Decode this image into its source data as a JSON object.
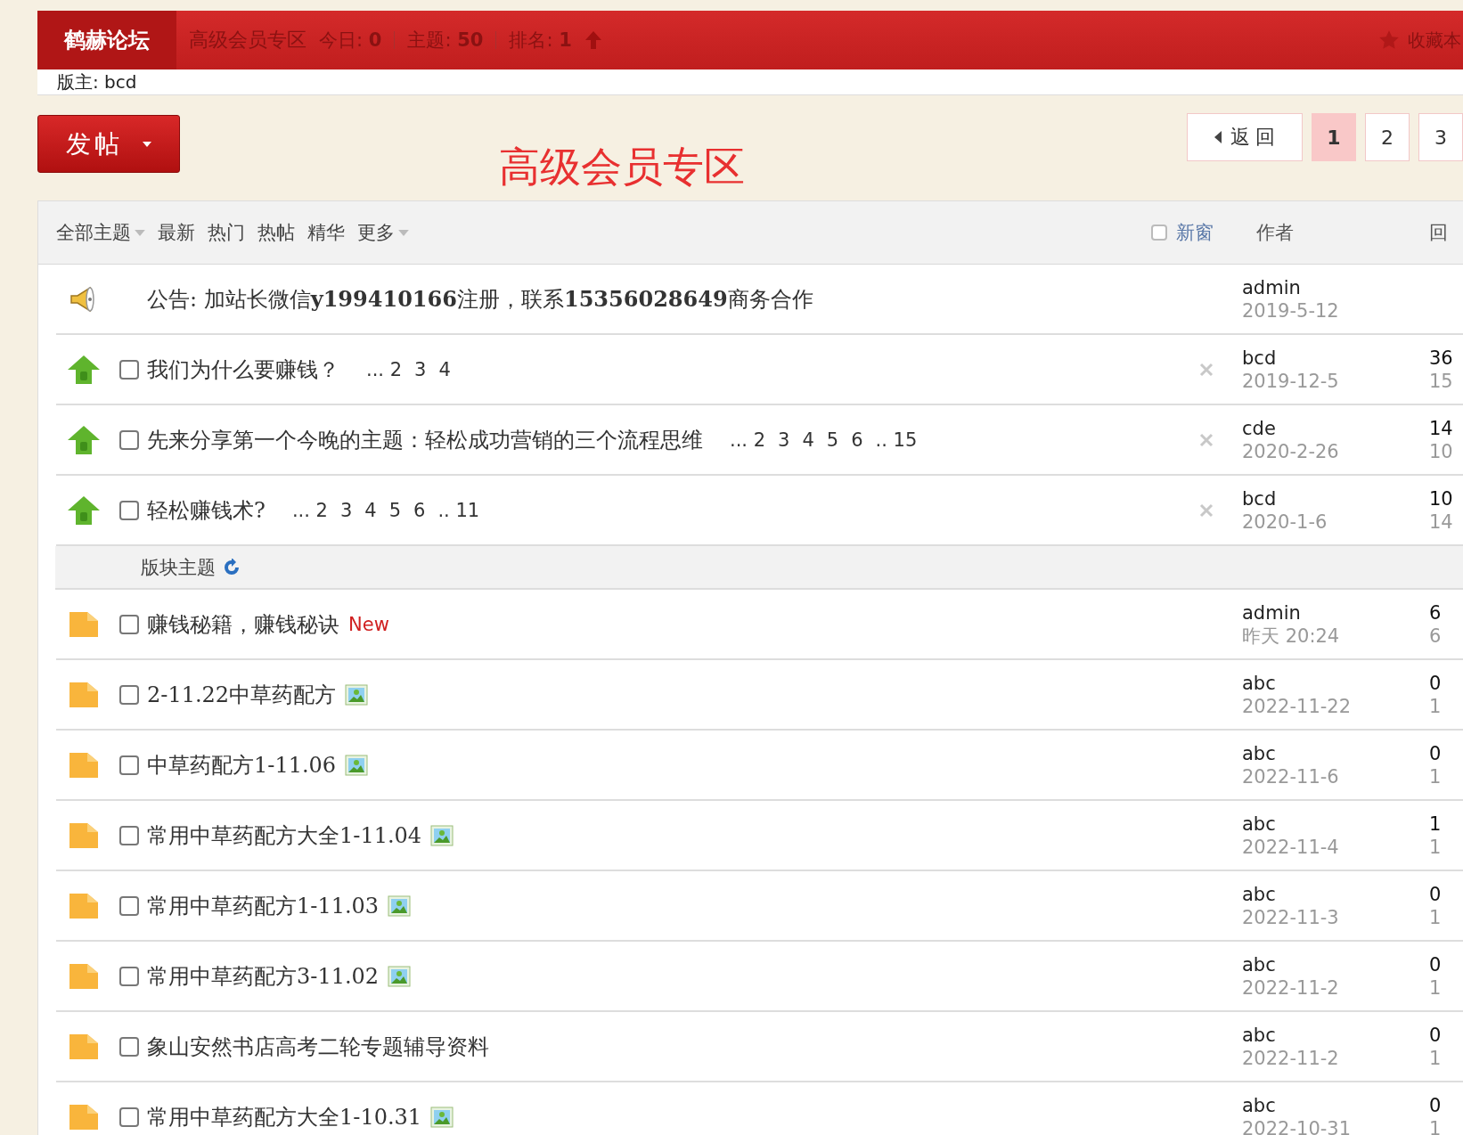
{
  "header": {
    "logo": "鹤赫论坛",
    "forum_name": "高级会员专区",
    "stats": [
      "今日: **0**",
      "主题: **50**",
      "排名: **1**"
    ],
    "moderator": "版主: bcd",
    "favorite": "收藏本"
  },
  "post_button": {
    "label": "发帖"
  },
  "forum_title": "高级会员专区",
  "pager": {
    "back": "返 回",
    "pages": [
      {
        "label": "1",
        "selected": true
      },
      {
        "label": "2",
        "selected": false
      },
      {
        "label": "3",
        "selected": false
      }
    ]
  },
  "filters": [
    {
      "label": "全部主题",
      "dropdown": true
    },
    {
      "label": "最新",
      "dropdown": false
    },
    {
      "label": "热门",
      "dropdown": false
    },
    {
      "label": "热帖",
      "dropdown": false
    },
    {
      "label": "精华",
      "dropdown": false
    },
    {
      "label": "更多",
      "dropdown": true
    }
  ],
  "new_window": {
    "label": "新窗",
    "checked": false
  },
  "columns": {
    "author": "作者",
    "replies": "回"
  },
  "threads": [
    {
      "kind": "announcement",
      "title": "公告: 加站长微信**y199410166**注册，联系**15356028649**商务合作",
      "author": "admin",
      "date": "2019-5-12"
    },
    {
      "kind": "sticky",
      "title": "我们为什么要赚钱？",
      "pages": [
        "... 2",
        "3",
        "4"
      ],
      "checked": false,
      "author": "bcd",
      "date": "2019-12-5",
      "replies": "36",
      "views": "15"
    },
    {
      "kind": "sticky",
      "title": "先来分享第一个今晚的主题：轻松成功营销的三个流程思维",
      "pages": [
        "... 2",
        "3",
        "4",
        "5",
        "6",
        ".. 15"
      ],
      "checked": false,
      "author": "cde",
      "date": "2020-2-26",
      "replies": "14",
      "views": "10"
    },
    {
      "kind": "sticky",
      "title": "轻松赚钱术?",
      "pages": [
        "... 2",
        "3",
        "4",
        "5",
        "6",
        ".. 11"
      ],
      "checked": false,
      "author": "bcd",
      "date": "2020-1-6",
      "replies": "10",
      "views": "14"
    },
    {
      "kind": "section",
      "title": "版块主题"
    },
    {
      "kind": "normal",
      "title": "赚钱秘籍，赚钱秘诀",
      "new": "New",
      "image": false,
      "checked": false,
      "author": "admin",
      "date": "昨天 20:24",
      "replies": "6",
      "views": "6"
    },
    {
      "kind": "normal",
      "title": "2-11.22中草药配方",
      "image": true,
      "checked": false,
      "author": "abc",
      "date": "2022-11-22",
      "replies": "0",
      "views": "1"
    },
    {
      "kind": "normal",
      "title": "中草药配方1-11.06",
      "image": true,
      "checked": false,
      "author": "abc",
      "date": "2022-11-6",
      "replies": "0",
      "views": "1"
    },
    {
      "kind": "normal",
      "title": "常用中草药配方大全1-11.04",
      "image": true,
      "checked": false,
      "author": "abc",
      "date": "2022-11-4",
      "replies": "1",
      "views": "1"
    },
    {
      "kind": "normal",
      "title": "常用中草药配方1-11.03",
      "image": true,
      "checked": false,
      "author": "abc",
      "date": "2022-11-3",
      "replies": "0",
      "views": "1"
    },
    {
      "kind": "normal",
      "title": "常用中草药配方3-11.02",
      "image": true,
      "checked": false,
      "author": "abc",
      "date": "2022-11-2",
      "replies": "0",
      "views": "1"
    },
    {
      "kind": "normal",
      "title": "象山安然书店高考二轮专题辅导资料",
      "image": false,
      "checked": false,
      "author": "abc",
      "date": "2022-11-2",
      "replies": "0",
      "views": "1"
    },
    {
      "kind": "normal",
      "title": "常用中草药配方大全1-10.31",
      "image": true,
      "checked": false,
      "author": "abc",
      "date": "2022-10-31",
      "replies": "0",
      "views": "1"
    }
  ]
}
